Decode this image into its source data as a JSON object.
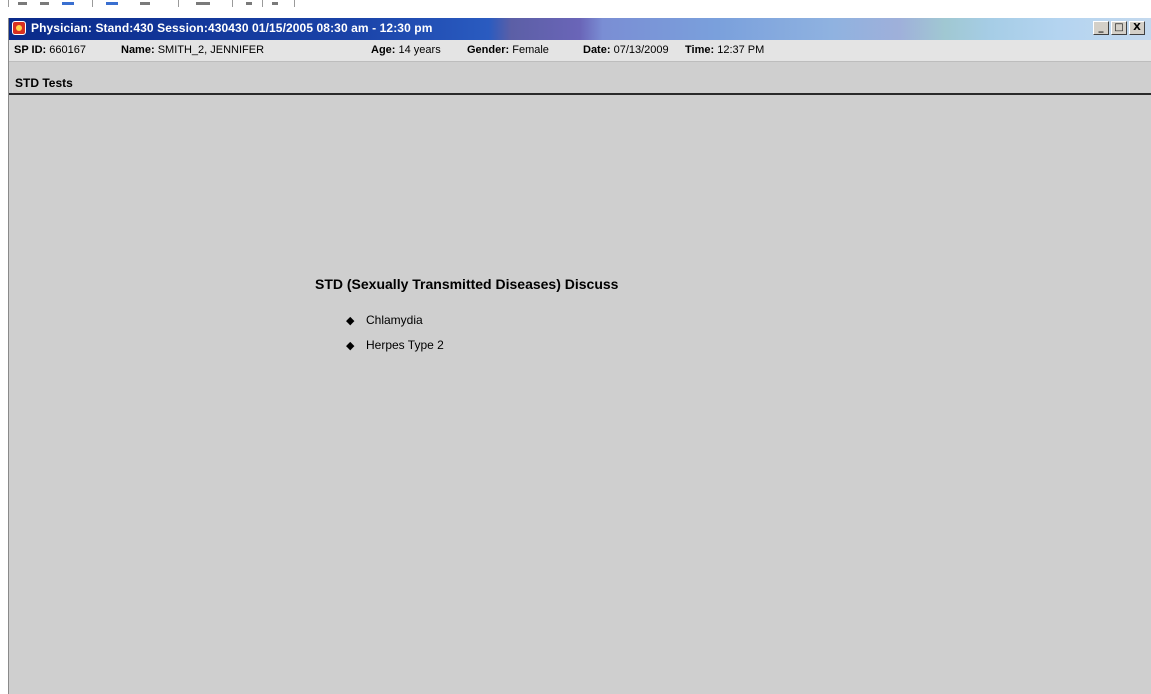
{
  "window": {
    "title": "Physician: Stand:430 Session:430430 01/15/2005 08:30 am - 12:30 pm",
    "controls": {
      "minimize": "_",
      "maximize": "□",
      "close": "X"
    }
  },
  "info_bar": {
    "sp_id_label": "SP ID:",
    "sp_id_value": "660167",
    "name_label": "Name:",
    "name_value": "SMITH_2, JENNIFER",
    "age_label": "Age:",
    "age_value": "14 years",
    "gender_label": "Gender:",
    "gender_value": "Female",
    "date_label": "Date:",
    "date_value": "07/13/2009",
    "time_label": "Time:",
    "time_value": "12:37 PM"
  },
  "section": {
    "title": "STD Tests"
  },
  "content": {
    "heading": "STD (Sexually Transmitted Diseases) Discuss",
    "bullet_icon": "diamond-bullet-icon",
    "items": [
      {
        "label": "Chlamydia"
      },
      {
        "label": "Herpes Type 2"
      }
    ]
  },
  "colors": {
    "title_bar_start": "#0a2a8a",
    "title_bar_end": "#c4d9ee",
    "window_background": "#cfcfcf",
    "info_bar_background": "#e4e4e4"
  }
}
